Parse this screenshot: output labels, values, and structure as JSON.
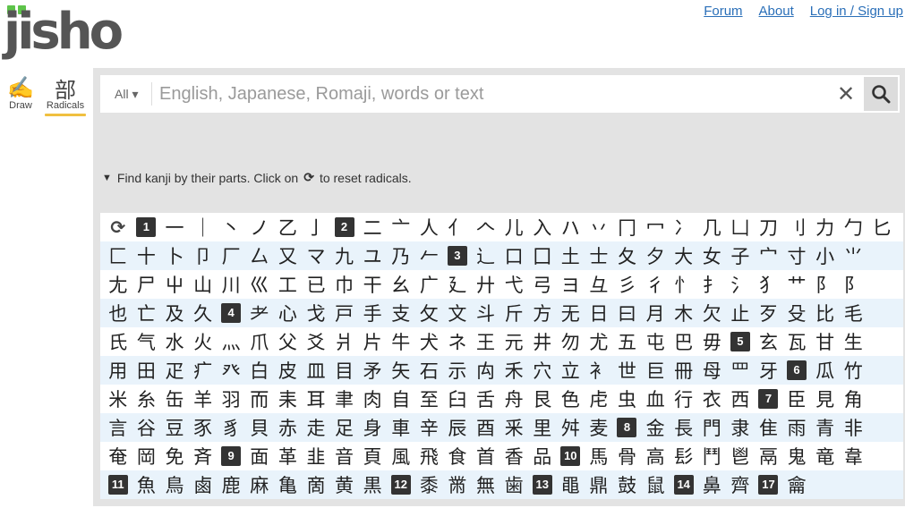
{
  "logo": {
    "text": "jisho"
  },
  "header": {
    "links": [
      "Forum",
      "About",
      "Log in / Sign up"
    ]
  },
  "modes": {
    "draw": {
      "icon": "✍",
      "label": "Draw"
    },
    "radicals": {
      "icon": "部",
      "label": "Radicals"
    }
  },
  "search": {
    "scope": "All ▾",
    "placeholder": "English, Japanese, Romaji, words or text",
    "clear_glyph": "✕"
  },
  "radicals": {
    "hint_prefix": "Find kanji by their parts. Click on",
    "hint_suffix": "to reset radicals.",
    "reset_glyph": "⟳",
    "rows": [
      [
        "⟳",
        "#1",
        "一",
        "｜",
        "丶",
        "ノ",
        "乙",
        "亅",
        "#2",
        "二",
        "亠",
        "人",
        "亻",
        "𠆢",
        "儿",
        "入",
        "ハ",
        "丷",
        "冂",
        "冖",
        "冫",
        "几",
        "凵",
        "刀",
        "刂",
        "力",
        "勹",
        "匕"
      ],
      [
        "匚",
        "十",
        "卜",
        "卩",
        "厂",
        "厶",
        "又",
        "マ",
        "九",
        "ユ",
        "乃",
        "𠂉",
        "#3",
        "⻌",
        "口",
        "囗",
        "土",
        "士",
        "夂",
        "夕",
        "大",
        "女",
        "子",
        "宀",
        "寸",
        "小",
        "⺌"
      ],
      [
        "尢",
        "尸",
        "屮",
        "山",
        "川",
        "巛",
        "工",
        "已",
        "巾",
        "干",
        "幺",
        "广",
        "廴",
        "廾",
        "弋",
        "弓",
        "ヨ",
        "彑",
        "彡",
        "彳",
        "忄",
        "扌",
        "氵",
        "犭",
        "艹",
        "阝",
        "阝"
      ],
      [
        "也",
        "亡",
        "及",
        "久",
        "#4",
        "耂",
        "心",
        "戈",
        "戸",
        "手",
        "支",
        "攵",
        "文",
        "斗",
        "斤",
        "方",
        "无",
        "日",
        "曰",
        "月",
        "木",
        "欠",
        "止",
        "歹",
        "殳",
        "比",
        "毛"
      ],
      [
        "氏",
        "气",
        "水",
        "火",
        "灬",
        "爪",
        "父",
        "爻",
        "爿",
        "片",
        "牛",
        "犬",
        "ネ",
        "王",
        "元",
        "井",
        "勿",
        "尤",
        "五",
        "屯",
        "巴",
        "毋",
        "#5",
        "玄",
        "瓦",
        "甘",
        "生"
      ],
      [
        "用",
        "田",
        "疋",
        "疒",
        "癶",
        "白",
        "皮",
        "皿",
        "目",
        "矛",
        "矢",
        "石",
        "示",
        "禸",
        "禾",
        "穴",
        "立",
        "衤",
        "世",
        "巨",
        "冊",
        "母",
        "罒",
        "牙",
        "#6",
        "瓜",
        "竹"
      ],
      [
        "米",
        "糸",
        "缶",
        "羊",
        "羽",
        "而",
        "耒",
        "耳",
        "聿",
        "肉",
        "自",
        "至",
        "臼",
        "舌",
        "舟",
        "艮",
        "色",
        "虍",
        "虫",
        "血",
        "行",
        "衣",
        "西",
        "#7",
        "臣",
        "見",
        "角"
      ],
      [
        "言",
        "谷",
        "豆",
        "豕",
        "豸",
        "貝",
        "赤",
        "走",
        "足",
        "身",
        "車",
        "辛",
        "辰",
        "酉",
        "釆",
        "里",
        "舛",
        "麦",
        "#8",
        "金",
        "長",
        "門",
        "隶",
        "隹",
        "雨",
        "青",
        "非"
      ],
      [
        "奄",
        "岡",
        "免",
        "斉",
        "#9",
        "面",
        "革",
        "韭",
        "音",
        "頁",
        "風",
        "飛",
        "食",
        "首",
        "香",
        "品",
        "#10",
        "馬",
        "骨",
        "高",
        "髟",
        "鬥",
        "鬯",
        "鬲",
        "鬼",
        "竜",
        "韋"
      ],
      [
        "#11",
        "魚",
        "鳥",
        "鹵",
        "鹿",
        "麻",
        "亀",
        "啇",
        "黄",
        "黒",
        "#12",
        "黍",
        "黹",
        "無",
        "歯",
        "#13",
        "黽",
        "鼎",
        "鼓",
        "鼠",
        "#14",
        "鼻",
        "齊",
        "#17",
        "龠"
      ]
    ]
  },
  "theme": {
    "accent": "#5ec44a",
    "link": "#2a6fb8",
    "panel": "#e3e3e3",
    "underline": "#f0c040"
  }
}
